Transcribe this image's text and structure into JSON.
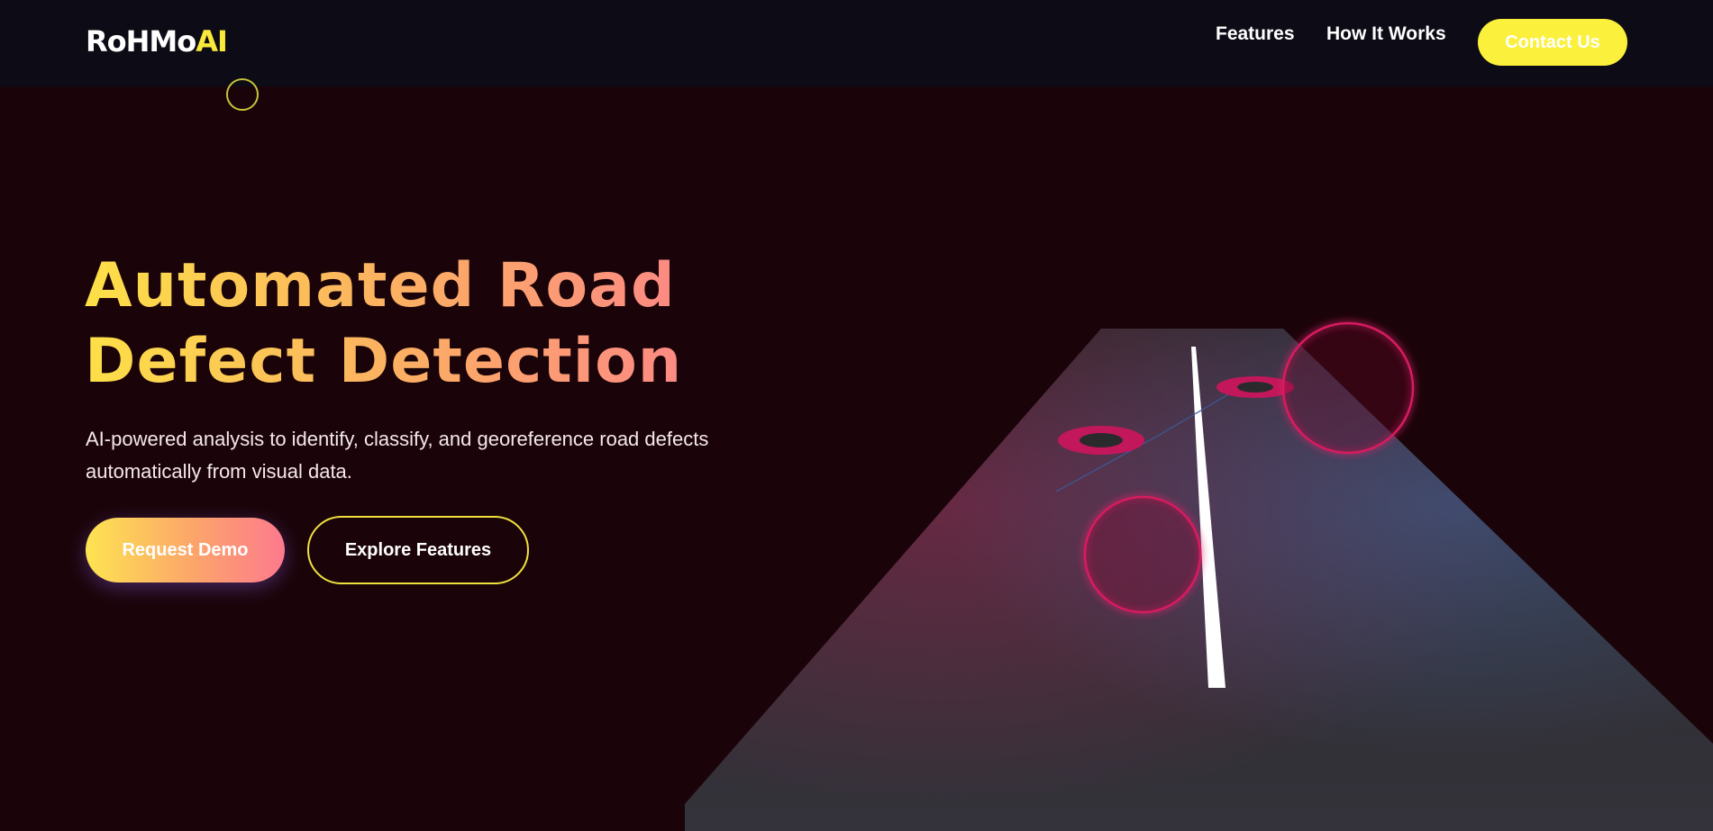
{
  "brand": {
    "name_main": "RoHMo",
    "name_accent": "AI",
    "accent_color": "#f9e93a"
  },
  "nav": {
    "links": [
      {
        "label": "Features"
      },
      {
        "label": "How It Works"
      }
    ],
    "cta_label": "Contact Us"
  },
  "hero": {
    "title_line1": "Automated Road",
    "title_line2": "Defect Detection",
    "subtitle_line1": "AI-powered analysis to identify, classify, and georeference road defects",
    "subtitle_line2": "automatically from visual data.",
    "primary_button": "Request Demo",
    "secondary_button": "Explore Features"
  },
  "illustration": {
    "subject": "road-with-defect-markers",
    "marker_color": "#d81b60",
    "road_color": "#2b2c31"
  },
  "colors": {
    "background": "#1b0409",
    "navbar": "#0d0c16",
    "cta": "#fbf03c",
    "gradient_start": "#fde047",
    "gradient_end": "#fd7e8e"
  }
}
